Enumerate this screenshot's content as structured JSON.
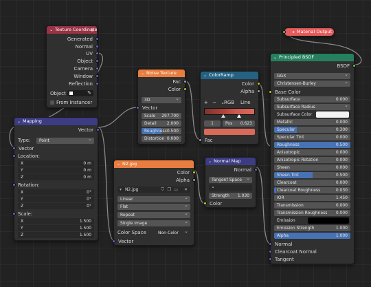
{
  "colors": {
    "texcoord_header": "#993345",
    "vector_header": "#3c3c83",
    "texture_header": "#e87d3e",
    "converter_header": "#246283",
    "shader_header": "#26805f",
    "output_header": "#e35b5b",
    "wire": "#8a8a8a"
  },
  "texcoord": {
    "title": "Texture Coordinate",
    "outputs": [
      "Generated",
      "Normal",
      "UV",
      "Object",
      "Camera",
      "Window",
      "Reflection"
    ],
    "object_label": "Object",
    "from_instancer": "From Instancer"
  },
  "mapping": {
    "title": "Mapping",
    "output": "Vector",
    "type_label": "Type:",
    "type_value": "Point",
    "input_vector": "Vector",
    "location_label": "Location:",
    "location": [
      {
        "axis": "X",
        "value": "0 m"
      },
      {
        "axis": "Y",
        "value": "0 m"
      },
      {
        "axis": "Z",
        "value": "0 m"
      }
    ],
    "rotation_label": "Rotation:",
    "rotation": [
      {
        "axis": "X",
        "value": "0°"
      },
      {
        "axis": "Y",
        "value": "0°"
      },
      {
        "axis": "Z",
        "value": "0°"
      }
    ],
    "scale_label": "Scale:",
    "scale": [
      {
        "axis": "X",
        "value": "1.500"
      },
      {
        "axis": "Y",
        "value": "1.500"
      },
      {
        "axis": "Z",
        "value": "1.500"
      }
    ]
  },
  "noise": {
    "title": "Noise Texture",
    "outputs": [
      "Fac",
      "Color"
    ],
    "dimensions": "3D",
    "input_vector": "Vector",
    "fields": [
      {
        "label": "Scale",
        "value": "297.700"
      },
      {
        "label": "Detail",
        "value": "2.000"
      },
      {
        "label": "Roughness",
        "value": "0.500"
      },
      {
        "label": "Distortion",
        "value": "0.000"
      }
    ]
  },
  "colorramp": {
    "title": "ColorRamp",
    "outputs": [
      "Color",
      "Alpha"
    ],
    "plus": "+",
    "minus": "−",
    "flip": "⌄",
    "mode": "RGB",
    "interp": "Line",
    "stop_index": "1",
    "pos_label": "Pos",
    "pos_value": "0.623",
    "input_fac": "Fac"
  },
  "image": {
    "title": "N2.jpg",
    "outputs": [
      "Color",
      "Alpha"
    ],
    "filename": "N2.jpg",
    "interpolation": "Linear",
    "projection": "Flat",
    "extension": "Repeat",
    "source": "Single Image",
    "colorspace_label": "Color Space",
    "colorspace_value": "Non-Color",
    "input_vector": "Vector"
  },
  "normalmap": {
    "title": "Normal Map",
    "output": "Normal",
    "space": "Tangent Space",
    "strength_label": "Strength",
    "strength_value": "1.030",
    "input_color": "Color"
  },
  "output": {
    "title": "Material Output"
  },
  "bsdf": {
    "title": "Principled BSDF",
    "output": "BSDF",
    "distribution": "GGX",
    "subsurface_method": "Christensen-Burley",
    "base_color": "Base Color",
    "fields": [
      {
        "label": "Subsurface",
        "value": "0.000",
        "kind": "field",
        "fill": 0
      },
      {
        "label": "Subsurface Radius",
        "value": "",
        "kind": "dropdown",
        "fill": 0
      },
      {
        "label": "Subsurface Color",
        "value": "",
        "kind": "color",
        "fill": 0
      },
      {
        "label": "Metallic",
        "value": "0.000",
        "kind": "field",
        "fill": 0
      },
      {
        "label": "Specular",
        "value": "0.300",
        "kind": "field",
        "fill": 0.3
      },
      {
        "label": "Specular Tint",
        "value": "0.000",
        "kind": "field",
        "fill": 0
      },
      {
        "label": "Roughness",
        "value": "0.500",
        "kind": "linked",
        "fill": 1
      },
      {
        "label": "Anisotropic",
        "value": "0.000",
        "kind": "field",
        "fill": 0
      },
      {
        "label": "Anisotropic Rotation",
        "value": "0.000",
        "kind": "field",
        "fill": 0
      },
      {
        "label": "Sheen",
        "value": "0.000",
        "kind": "field",
        "fill": 0
      },
      {
        "label": "Sheen Tint",
        "value": "0.500",
        "kind": "field",
        "fill": 0.5
      },
      {
        "label": "Clearcoat",
        "value": "0.000",
        "kind": "field",
        "fill": 0
      },
      {
        "label": "Clearcoat Roughness",
        "value": "0.030",
        "kind": "field",
        "fill": 0.03
      },
      {
        "label": "IOR",
        "value": "1.450",
        "kind": "field",
        "fill": 0
      },
      {
        "label": "Transmission",
        "value": "0.000",
        "kind": "field",
        "fill": 0
      },
      {
        "label": "Transmission Roughness",
        "value": "0.000",
        "kind": "field",
        "fill": 0
      },
      {
        "label": "Emission",
        "value": "",
        "kind": "emission",
        "fill": 0
      },
      {
        "label": "Emission Strength",
        "value": "1.000",
        "kind": "field",
        "fill": 0
      },
      {
        "label": "Alpha",
        "value": "1.000",
        "kind": "field",
        "fill": 1
      }
    ],
    "normal": "Normal",
    "clearcoat_normal": "Clearcoat Normal",
    "tangent": "Tangent"
  }
}
